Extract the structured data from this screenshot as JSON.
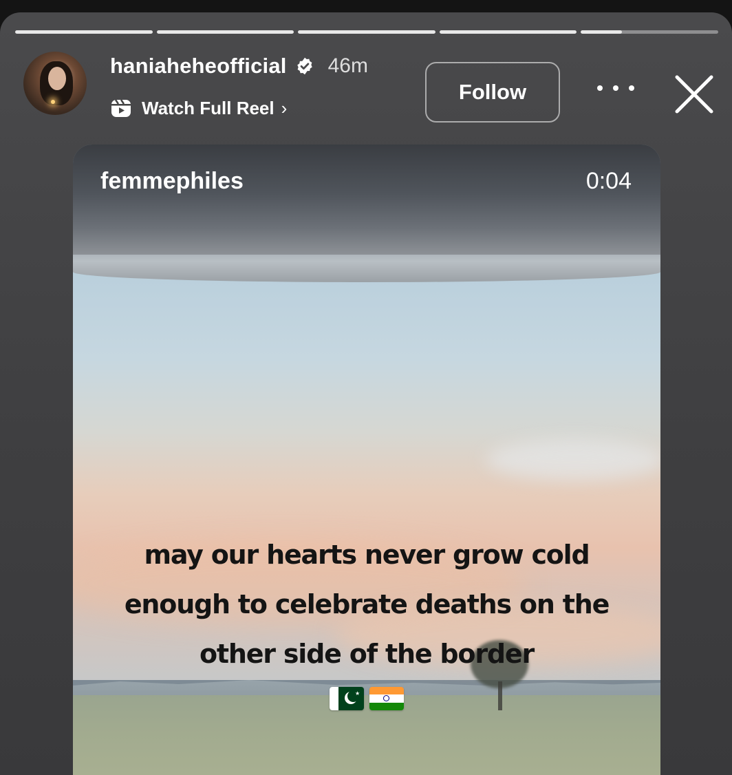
{
  "progress": {
    "segments": 5,
    "active_segment": 5,
    "active_fill": 0.3
  },
  "header": {
    "username": "haniaheheofficial",
    "verified_icon": "verified-badge-icon",
    "time_ago": "46m",
    "watch_full_reel": "Watch Full Reel",
    "chevron": "›",
    "follow_label": "Follow"
  },
  "video": {
    "source": "femmephiles",
    "duration": "0:04",
    "caption_lines": [
      "may our hearts never grow cold",
      "enough to celebrate deaths on the",
      "other side of the border"
    ],
    "flags": [
      "pakistan-flag-icon",
      "india-flag-icon"
    ]
  }
}
